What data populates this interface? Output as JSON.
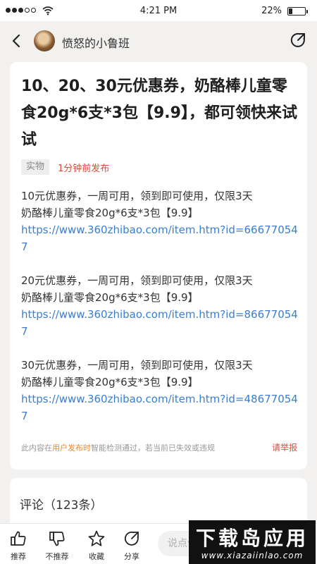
{
  "status_bar": {
    "time": "4:21 PM",
    "battery": "22%",
    "battery_level": 0.22
  },
  "nav": {
    "title": "愤怒的小鲁班",
    "back_icon": "chevron-left-icon",
    "share_icon": "share-circle-icon"
  },
  "post": {
    "title": "10、20、30元优惠券，奶酪棒儿童零食20g*6支*3包【9.9】，都可领快来试试",
    "tag": "实物",
    "published": "1分钟前发布",
    "coupons": [
      {
        "line1": "10元优惠券，一周可用，领到即可使用，仅限3天",
        "line2": "奶酪棒儿童零食20g*6支*3包【9.9】",
        "link": "https://www.360zhibao.com/item.htm?id=666770547"
      },
      {
        "line1": "20元优惠券，一周可用，领到即可使用，仅限3天",
        "line2": "奶酪棒儿童零食20g*6支*3包【9.9】",
        "link": "https://www.360zhibao.com/item.htm?id=866770547"
      },
      {
        "line1": "30元优惠券，一周可用，领到即可使用，仅限3天",
        "line2": "奶酪棒儿童零食20g*6支*3包【9.9】",
        "link": "https://www.360zhibao.com/item.htm?id=486770547"
      }
    ],
    "disclaimer_prefix": "此内容在",
    "disclaimer_highlight": "用户发布时",
    "disclaimer_suffix": "智能检测通过，若当前已失效或违规",
    "report": "请举报"
  },
  "comments": {
    "title": "评论（123条）"
  },
  "bottom_bar": {
    "like": "推荐",
    "dislike": "不推荐",
    "favorite": "收藏",
    "share": "分享",
    "input_placeholder": "说点什么"
  },
  "watermark": {
    "main": "下载岛应用",
    "sub": "www.xiazaiinlao.com"
  },
  "colors": {
    "accent_red": "#e04a3a",
    "link_blue": "#3a7ecf",
    "highlight_orange": "#e98a2a",
    "page_background": "#f2f1ef"
  }
}
